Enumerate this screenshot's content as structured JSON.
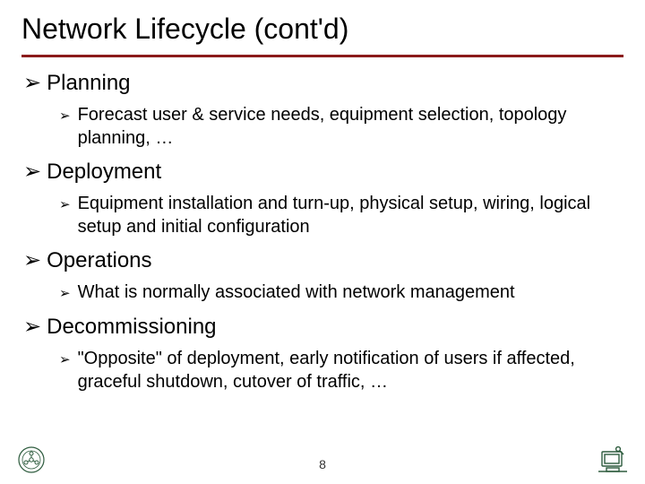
{
  "title": "Network Lifecycle (cont'd)",
  "bullet_glyph": "➢",
  "sections": [
    {
      "heading": "Planning",
      "sub": "Forecast user & service needs, equipment selection, topology planning, …"
    },
    {
      "heading": "Deployment",
      "sub": "Equipment installation and turn-up, physical setup, wiring, logical setup and initial configuration"
    },
    {
      "heading": "Operations",
      "sub": "What is normally associated with network management"
    },
    {
      "heading": "Decommissioning",
      "sub": "\"Opposite\" of deployment, early notification of users if affected, graceful shutdown, cutover of traffic, …"
    }
  ],
  "page_number": "8",
  "colors": {
    "rule": "#8b1a1a",
    "logo": "#2e5c3e"
  }
}
